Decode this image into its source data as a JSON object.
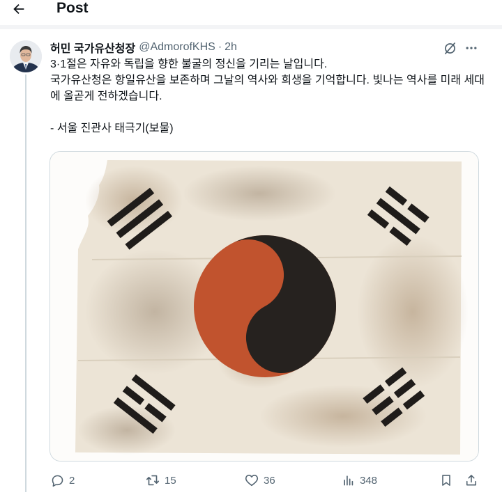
{
  "header": {
    "title": "Post",
    "back_icon": "arrow-left-icon"
  },
  "post": {
    "author_name": "허민 국가유산청장",
    "author_handle": "@AdmorofKHS",
    "separator": "·",
    "time": "2h",
    "text_lines": [
      "3·1절은 자유와 독립을 향한 불굴의 정신을 기리는 날입니다.",
      "국가유산청은 항일유산을 보존하며 그날의 역사와 희생을 기억합니다. 빛나는 역사를 미래 세대에 올곧게 전하겠습니다.",
      "- 서울 진관사 태극기(보물)"
    ],
    "media_description_icon": "taegeukgi-flag-image"
  },
  "actions": {
    "replies": "2",
    "reposts": "15",
    "likes": "36",
    "views": "348"
  },
  "colors": {
    "text": "#0f1419",
    "secondary": "#536471",
    "border": "#cfd9de",
    "flag_red": "#c1532e",
    "flag_black": "#26221f",
    "cloth": "#ece4d6"
  }
}
